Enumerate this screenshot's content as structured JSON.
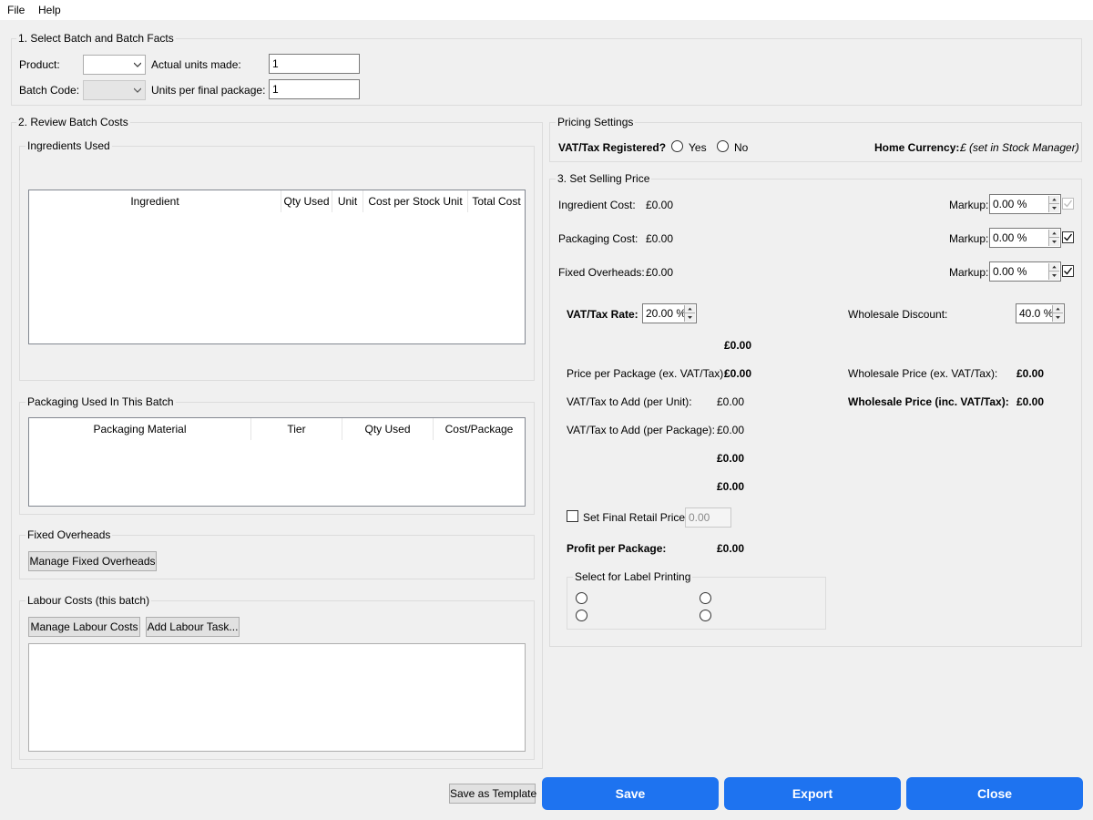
{
  "menu": {
    "file": "File",
    "help": "Help"
  },
  "batch": {
    "title": "1. Select Batch and Batch Facts",
    "product_label": "Product:",
    "product_value": "",
    "batch_code_label": "Batch Code:",
    "batch_code_value": "",
    "actual_units_label": "Actual units made:",
    "actual_units_value": "1",
    "units_per_package_label": "Units per final package:",
    "units_per_package_value": "1"
  },
  "review": {
    "title": "2. Review Batch Costs",
    "ingredients": {
      "title": "Ingredients Used",
      "columns": [
        "Ingredient",
        "Qty Used",
        "Unit",
        "Cost per Stock Unit",
        "Total Cost"
      ]
    },
    "packaging": {
      "title": "Packaging Used In This Batch",
      "columns": [
        "Packaging Material",
        "Tier",
        "Qty Used",
        "Cost/Package"
      ]
    },
    "fixed_overheads": {
      "title": "Fixed Overheads",
      "manage_button": "Manage Fixed Overheads"
    },
    "labour": {
      "title": "Labour Costs (this batch)",
      "manage_button": "Manage Labour Costs",
      "add_button": "Add Labour Task..."
    }
  },
  "pricing_settings": {
    "title": "Pricing Settings",
    "vat_registered_label": "VAT/Tax Registered?",
    "yes": "Yes",
    "no": "No",
    "home_currency_label": "Home Currency:",
    "home_currency_value": "£ (set in Stock Manager)"
  },
  "selling": {
    "title": "3. Set Selling Price",
    "ingredient_cost_label": "Ingredient Cost:",
    "ingredient_cost_value": "£0.00",
    "packaging_cost_label": "Packaging Cost:",
    "packaging_cost_value": "£0.00",
    "fixed_overheads_label": "Fixed Overheads:",
    "fixed_overheads_value": "£0.00",
    "markup_label": "Markup:",
    "markup_ingredient": "0.00 %",
    "markup_packaging": "0.00 %",
    "markup_fixed": "0.00 %",
    "vat_rate_label": "VAT/Tax Rate:",
    "vat_rate_value": "20.00 %",
    "wholesale_discount_label": "Wholesale Discount:",
    "wholesale_discount_value": "40.0 %",
    "subtotal_value": "£0.00",
    "price_per_package_label": "Price per Package (ex. VAT/Tax):",
    "price_per_package_value": "£0.00",
    "vat_per_unit_label": "VAT/Tax to Add (per Unit):",
    "vat_per_unit_value": "£0.00",
    "vat_per_package_label": "VAT/Tax to Add (per Package):",
    "vat_per_package_value": "£0.00",
    "total_value_1": "£0.00",
    "total_value_2": "£0.00",
    "wholesale_ex_label": "Wholesale Price (ex. VAT/Tax):",
    "wholesale_ex_value": "£0.00",
    "wholesale_inc_label": "Wholesale Price (inc. VAT/Tax):",
    "wholesale_inc_value": "£0.00",
    "final_retail_label": "Set Final Retail Price:",
    "final_retail_value": "0.00",
    "profit_label": "Profit per Package:",
    "profit_value": "£0.00",
    "label_printing_title": "Select for Label Printing"
  },
  "footer": {
    "save_template": "Save as Template",
    "save": "Save",
    "export": "Export",
    "close": "Close"
  },
  "colors": {
    "primary": "#1e73f0",
    "background": "#f0f0f0"
  }
}
